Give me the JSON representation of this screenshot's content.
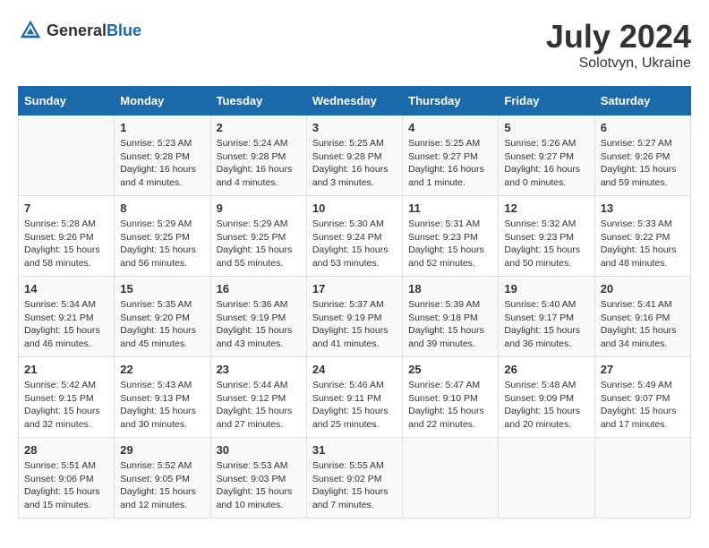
{
  "header": {
    "logo_general": "General",
    "logo_blue": "Blue",
    "month": "July 2024",
    "location": "Solotvyn, Ukraine"
  },
  "days_of_week": [
    "Sunday",
    "Monday",
    "Tuesday",
    "Wednesday",
    "Thursday",
    "Friday",
    "Saturday"
  ],
  "weeks": [
    [
      {
        "day": "",
        "info": ""
      },
      {
        "day": "1",
        "info": "Sunrise: 5:23 AM\nSunset: 9:28 PM\nDaylight: 16 hours\nand 4 minutes."
      },
      {
        "day": "2",
        "info": "Sunrise: 5:24 AM\nSunset: 9:28 PM\nDaylight: 16 hours\nand 4 minutes."
      },
      {
        "day": "3",
        "info": "Sunrise: 5:25 AM\nSunset: 9:28 PM\nDaylight: 16 hours\nand 3 minutes."
      },
      {
        "day": "4",
        "info": "Sunrise: 5:25 AM\nSunset: 9:27 PM\nDaylight: 16 hours\nand 1 minute."
      },
      {
        "day": "5",
        "info": "Sunrise: 5:26 AM\nSunset: 9:27 PM\nDaylight: 16 hours\nand 0 minutes."
      },
      {
        "day": "6",
        "info": "Sunrise: 5:27 AM\nSunset: 9:26 PM\nDaylight: 15 hours\nand 59 minutes."
      }
    ],
    [
      {
        "day": "7",
        "info": "Sunrise: 5:28 AM\nSunset: 9:26 PM\nDaylight: 15 hours\nand 58 minutes."
      },
      {
        "day": "8",
        "info": "Sunrise: 5:29 AM\nSunset: 9:25 PM\nDaylight: 15 hours\nand 56 minutes."
      },
      {
        "day": "9",
        "info": "Sunrise: 5:29 AM\nSunset: 9:25 PM\nDaylight: 15 hours\nand 55 minutes."
      },
      {
        "day": "10",
        "info": "Sunrise: 5:30 AM\nSunset: 9:24 PM\nDaylight: 15 hours\nand 53 minutes."
      },
      {
        "day": "11",
        "info": "Sunrise: 5:31 AM\nSunset: 9:23 PM\nDaylight: 15 hours\nand 52 minutes."
      },
      {
        "day": "12",
        "info": "Sunrise: 5:32 AM\nSunset: 9:23 PM\nDaylight: 15 hours\nand 50 minutes."
      },
      {
        "day": "13",
        "info": "Sunrise: 5:33 AM\nSunset: 9:22 PM\nDaylight: 15 hours\nand 48 minutes."
      }
    ],
    [
      {
        "day": "14",
        "info": "Sunrise: 5:34 AM\nSunset: 9:21 PM\nDaylight: 15 hours\nand 46 minutes."
      },
      {
        "day": "15",
        "info": "Sunrise: 5:35 AM\nSunset: 9:20 PM\nDaylight: 15 hours\nand 45 minutes."
      },
      {
        "day": "16",
        "info": "Sunrise: 5:36 AM\nSunset: 9:19 PM\nDaylight: 15 hours\nand 43 minutes."
      },
      {
        "day": "17",
        "info": "Sunrise: 5:37 AM\nSunset: 9:19 PM\nDaylight: 15 hours\nand 41 minutes."
      },
      {
        "day": "18",
        "info": "Sunrise: 5:39 AM\nSunset: 9:18 PM\nDaylight: 15 hours\nand 39 minutes."
      },
      {
        "day": "19",
        "info": "Sunrise: 5:40 AM\nSunset: 9:17 PM\nDaylight: 15 hours\nand 36 minutes."
      },
      {
        "day": "20",
        "info": "Sunrise: 5:41 AM\nSunset: 9:16 PM\nDaylight: 15 hours\nand 34 minutes."
      }
    ],
    [
      {
        "day": "21",
        "info": "Sunrise: 5:42 AM\nSunset: 9:15 PM\nDaylight: 15 hours\nand 32 minutes."
      },
      {
        "day": "22",
        "info": "Sunrise: 5:43 AM\nSunset: 9:13 PM\nDaylight: 15 hours\nand 30 minutes."
      },
      {
        "day": "23",
        "info": "Sunrise: 5:44 AM\nSunset: 9:12 PM\nDaylight: 15 hours\nand 27 minutes."
      },
      {
        "day": "24",
        "info": "Sunrise: 5:46 AM\nSunset: 9:11 PM\nDaylight: 15 hours\nand 25 minutes."
      },
      {
        "day": "25",
        "info": "Sunrise: 5:47 AM\nSunset: 9:10 PM\nDaylight: 15 hours\nand 22 minutes."
      },
      {
        "day": "26",
        "info": "Sunrise: 5:48 AM\nSunset: 9:09 PM\nDaylight: 15 hours\nand 20 minutes."
      },
      {
        "day": "27",
        "info": "Sunrise: 5:49 AM\nSunset: 9:07 PM\nDaylight: 15 hours\nand 17 minutes."
      }
    ],
    [
      {
        "day": "28",
        "info": "Sunrise: 5:51 AM\nSunset: 9:06 PM\nDaylight: 15 hours\nand 15 minutes."
      },
      {
        "day": "29",
        "info": "Sunrise: 5:52 AM\nSunset: 9:05 PM\nDaylight: 15 hours\nand 12 minutes."
      },
      {
        "day": "30",
        "info": "Sunrise: 5:53 AM\nSunset: 9:03 PM\nDaylight: 15 hours\nand 10 minutes."
      },
      {
        "day": "31",
        "info": "Sunrise: 5:55 AM\nSunset: 9:02 PM\nDaylight: 15 hours\nand 7 minutes."
      },
      {
        "day": "",
        "info": ""
      },
      {
        "day": "",
        "info": ""
      },
      {
        "day": "",
        "info": ""
      }
    ]
  ]
}
